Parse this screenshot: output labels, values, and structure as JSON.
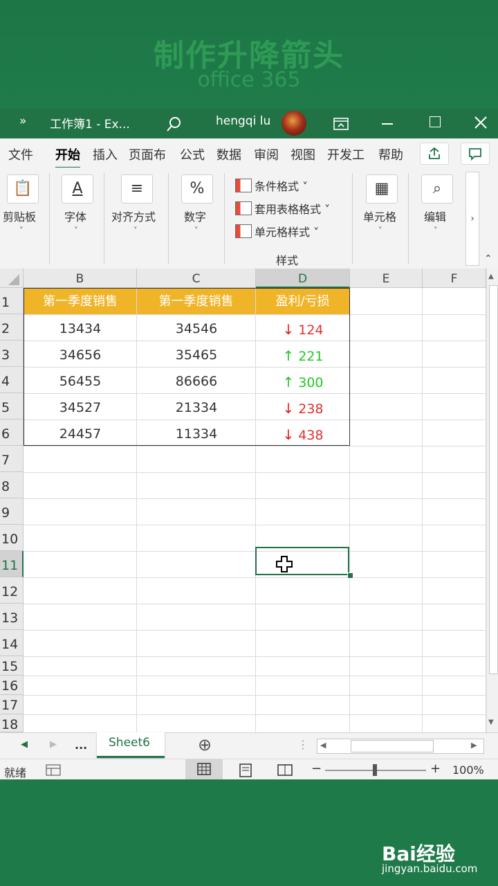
{
  "banner": {
    "title": "制作升降箭头",
    "subtitle": "office 365"
  },
  "titlebar": {
    "more": "»",
    "title": "工作簿1  -  Ex...",
    "user": "hengqi lu"
  },
  "ribbon_tabs": [
    "文件",
    "开始",
    "插入",
    "页面布",
    "公式",
    "数据",
    "审阅",
    "视图",
    "开发工",
    "帮助"
  ],
  "ribbon_groups": {
    "clipboard": "剪贴板",
    "font": "字体",
    "align": "对齐方式",
    "number": "数字",
    "cond_format": "条件格式 ˅",
    "table_format": "套用表格格式 ˅",
    "cell_style": "单元格样式 ˅",
    "styles_group": "样式",
    "cells": "单元格",
    "edit": "编辑"
  },
  "columns": [
    "B",
    "C",
    "D",
    "E",
    "F"
  ],
  "row_numbers": [
    "1",
    "2",
    "3",
    "4",
    "5",
    "6",
    "7",
    "8",
    "9",
    "10",
    "11",
    "12",
    "13",
    "14",
    "15",
    "16",
    "17",
    "18"
  ],
  "table": {
    "headers": [
      "第一季度销售",
      "第一季度销售",
      "盈利/亏损"
    ],
    "rows": [
      {
        "b": "13434",
        "c": "34546",
        "arrow": "↓",
        "d": "124",
        "dir": "down"
      },
      {
        "b": "34656",
        "c": "35465",
        "arrow": "↑",
        "d": "221",
        "dir": "up"
      },
      {
        "b": "56455",
        "c": "86666",
        "arrow": "↑",
        "d": "300",
        "dir": "up"
      },
      {
        "b": "34527",
        "c": "21334",
        "arrow": "↓",
        "d": "238",
        "dir": "down"
      },
      {
        "b": "24457",
        "c": "11334",
        "arrow": "↓",
        "d": "438",
        "dir": "down"
      }
    ]
  },
  "sheet": {
    "ellipsis": "...",
    "name": "Sheet6",
    "add": "⊕"
  },
  "status": {
    "ready": "就绪",
    "zoom": "100%",
    "minus": "−",
    "plus": "+"
  },
  "watermark": {
    "brand": "Bai经验",
    "url": "jingyan.baidu.com"
  },
  "colors": {
    "excel_green": "#217346",
    "header_gold": "#f0b428",
    "down_red": "#e02020",
    "up_green": "#22c722"
  }
}
